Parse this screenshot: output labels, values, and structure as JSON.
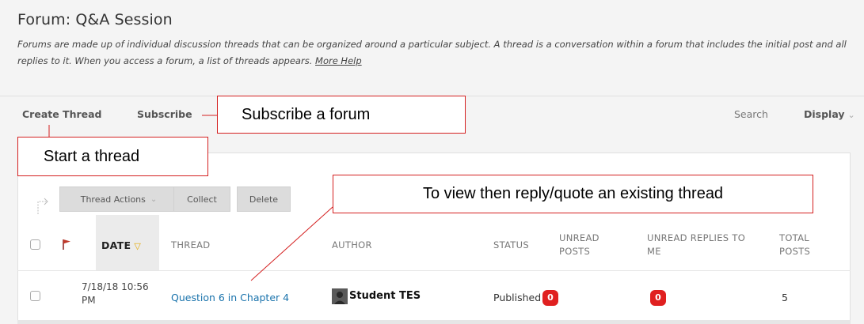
{
  "forum": {
    "title": "Forum: Q&A Session",
    "description": "Forums are made up of individual discussion threads that can be organized around a particular subject. A thread is a conversation within a forum that includes the initial post and all replies to it. When you access a forum, a list of threads appears.",
    "more_help": "More Help"
  },
  "action_bar": {
    "create_thread": "Create Thread",
    "subscribe": "Subscribe",
    "search": "Search",
    "display": "Display",
    "display_icon": "chevron-down-icon"
  },
  "toolbar": {
    "thread_actions": "Thread Actions",
    "collect": "Collect",
    "delete": "Delete"
  },
  "table": {
    "columns": {
      "date": "DATE",
      "thread": "THREAD",
      "author": "AUTHOR",
      "status": "STATUS",
      "unread_posts": "UNREAD POSTS",
      "unread_replies": "UNREAD REPLIES TO ME",
      "total_posts": "TOTAL POSTS"
    },
    "rows": [
      {
        "date": "7/18/18 10:56 PM",
        "thread": "Question 6 in Chapter 4",
        "author": "Student TES",
        "status": "Published",
        "unread_posts": "0",
        "unread_replies": "0",
        "total_posts": "5"
      }
    ]
  },
  "callouts": {
    "subscribe": "Subscribe a forum",
    "start": "Start a thread",
    "view": "To view then reply/quote an existing thread"
  },
  "colors": {
    "callout_border": "#d42020",
    "badge": "#e02020",
    "link": "#1a73ac",
    "sort_indicator": "#e5a800"
  }
}
